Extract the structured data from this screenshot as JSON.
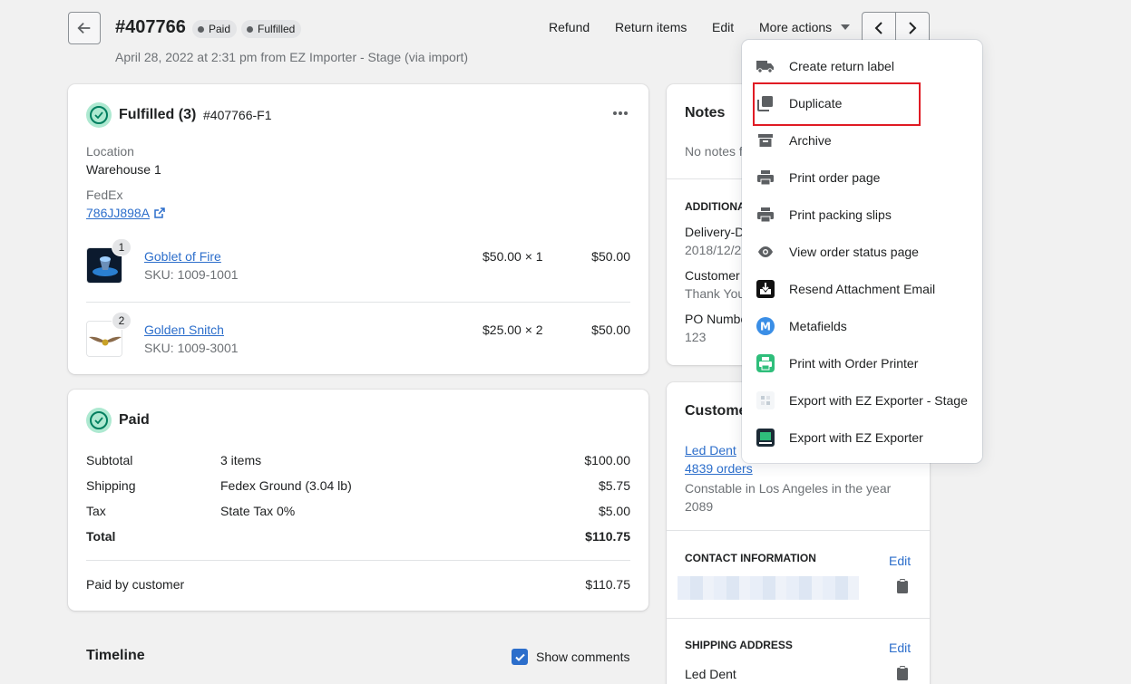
{
  "header": {
    "order_number": "#407766",
    "badges": [
      "Paid",
      "Fulfilled"
    ],
    "subtitle": "April 28, 2022 at 2:31 pm from EZ Importer - Stage (via import)",
    "actions": {
      "refund": "Refund",
      "return_items": "Return items",
      "edit": "Edit",
      "more_actions": "More actions"
    }
  },
  "fulfilled_card": {
    "title": "Fulfilled (3)",
    "fulfillment_id": "#407766-F1",
    "location_label": "Location",
    "location_value": "Warehouse 1",
    "carrier": "FedEx",
    "tracking": "786JJ898A",
    "items": [
      {
        "qty_badge": "1",
        "name": "Goblet of Fire",
        "sku": "SKU: 1009-1001",
        "price_qty": "$50.00 × 1",
        "total": "$50.00"
      },
      {
        "qty_badge": "2",
        "name": "Golden Snitch",
        "sku": "SKU: 1009-3001",
        "price_qty": "$25.00 × 2",
        "total": "$50.00"
      }
    ]
  },
  "paid_card": {
    "title": "Paid",
    "rows": [
      {
        "label": "Subtotal",
        "detail": "3 items",
        "amount": "$100.00"
      },
      {
        "label": "Shipping",
        "detail": "Fedex Ground (3.04 lb)",
        "amount": "$5.75"
      },
      {
        "label": "Tax",
        "detail": "State Tax 0%",
        "amount": "$5.00"
      },
      {
        "label": "Total",
        "detail": "",
        "amount": "$110.75"
      }
    ],
    "paid_by_label": "Paid by customer",
    "paid_by_amount": "$110.75"
  },
  "timeline": {
    "title": "Timeline",
    "show_comments": "Show comments"
  },
  "notes_card": {
    "title": "Notes",
    "empty": "No notes f",
    "additional_caption": "ADDITIONA",
    "fields": [
      {
        "label": "Delivery-D",
        "value": "2018/12/2"
      },
      {
        "label": "Customer",
        "value": "Thank You"
      },
      {
        "label": "PO Numbe",
        "value": "123"
      }
    ]
  },
  "customer_card": {
    "title": "Custome",
    "name": "Led Dent",
    "orders": "4839 orders",
    "bio": "Constable in Los Angeles in the year 2089",
    "contact_caption": "CONTACT INFORMATION",
    "contact_edit": "Edit",
    "shipping_caption": "SHIPPING ADDRESS",
    "shipping_edit": "Edit",
    "shipping_name": "Led Dent"
  },
  "more_actions_menu": {
    "items": [
      {
        "label": "Create return label",
        "icon": "truck-icon"
      },
      {
        "label": "Duplicate",
        "icon": "duplicate-icon"
      },
      {
        "label": "Archive",
        "icon": "archive-icon"
      },
      {
        "label": "Print order page",
        "icon": "printer-icon"
      },
      {
        "label": "Print packing slips",
        "icon": "printer-icon"
      },
      {
        "label": "View order status page",
        "icon": "eye-icon"
      },
      {
        "label": "Resend Attachment Email",
        "icon": "download-app-icon"
      },
      {
        "label": "Metafields",
        "icon": "metafields-app-icon"
      },
      {
        "label": "Print with Order Printer",
        "icon": "order-printer-app-icon"
      },
      {
        "label": "Export with EZ Exporter - Stage",
        "icon": "ez-exporter-stage-app-icon"
      },
      {
        "label": "Export with EZ Exporter",
        "icon": "ez-exporter-app-icon"
      }
    ]
  },
  "colors": {
    "accent_link": "#2c6ecb",
    "success": "#007f5f",
    "highlight_box": "#e01b24"
  }
}
